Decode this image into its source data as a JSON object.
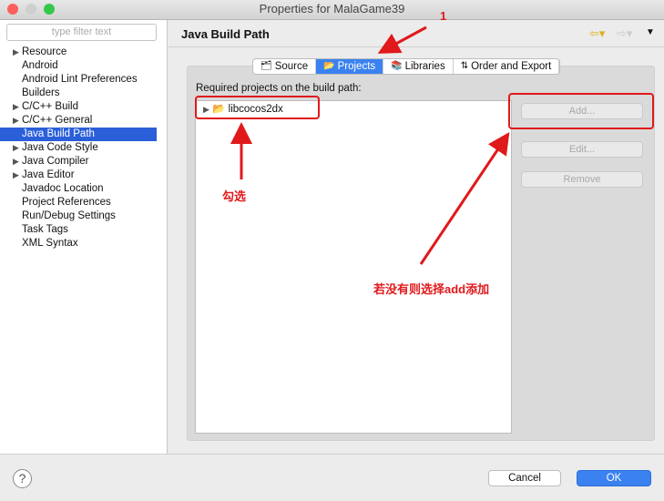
{
  "window": {
    "title": "Properties for MalaGame39"
  },
  "sidebar": {
    "filter_placeholder": "type filter text",
    "items": [
      {
        "label": "Resource",
        "expandable": true
      },
      {
        "label": "Android"
      },
      {
        "label": "Android Lint Preferences"
      },
      {
        "label": "Builders"
      },
      {
        "label": "C/C++ Build",
        "expandable": true
      },
      {
        "label": "C/C++ General",
        "expandable": true
      },
      {
        "label": "Java Build Path",
        "selected": true
      },
      {
        "label": "Java Code Style",
        "expandable": true
      },
      {
        "label": "Java Compiler",
        "expandable": true
      },
      {
        "label": "Java Editor",
        "expandable": true
      },
      {
        "label": "Javadoc Location"
      },
      {
        "label": "Project References"
      },
      {
        "label": "Run/Debug Settings"
      },
      {
        "label": "Task Tags"
      },
      {
        "label": "XML Syntax"
      }
    ]
  },
  "header": {
    "title": "Java Build Path"
  },
  "tabs": [
    {
      "label": "Source",
      "icon": "source-folder-icon"
    },
    {
      "label": "Projects",
      "icon": "project-folder-icon",
      "active": true
    },
    {
      "label": "Libraries",
      "icon": "libraries-icon"
    },
    {
      "label": "Order and Export",
      "icon": "order-export-icon"
    }
  ],
  "projects": {
    "label": "Required projects on the build path:",
    "items": [
      {
        "label": "libcocos2dx"
      }
    ]
  },
  "buttons": {
    "add": "Add...",
    "edit": "Edit...",
    "remove": "Remove"
  },
  "footer": {
    "cancel": "Cancel",
    "ok": "OK"
  },
  "annotations": {
    "step": "1",
    "check_note": "勾选",
    "add_note": "若没有则选择add添加",
    "color": "#e0191b"
  },
  "colors": {
    "selection": "#2b5fd9",
    "ok_button": "#3b82f0"
  }
}
